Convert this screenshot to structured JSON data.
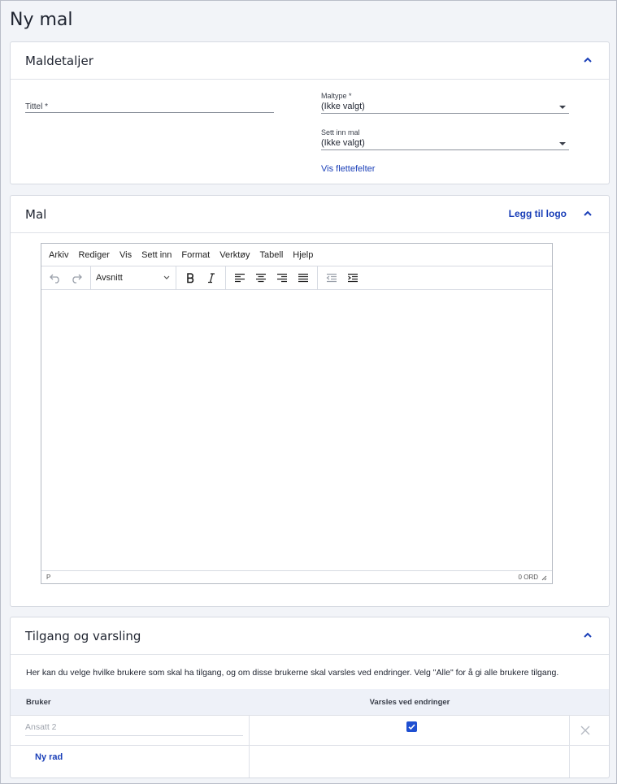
{
  "page": {
    "title": "Ny mal"
  },
  "details": {
    "title": "Maldetaljer",
    "tittel_label": "Tittel *",
    "tittel_value": "",
    "maltype_label": "Maltype *",
    "maltype_value": "(Ikke valgt)",
    "sett_inn_label": "Sett inn mal",
    "sett_inn_value": "(Ikke valgt)",
    "vis_flettefelter": "Vis flettefelter"
  },
  "mal": {
    "title": "Mal",
    "add_logo": "Legg til logo",
    "menu": [
      "Arkiv",
      "Rediger",
      "Vis",
      "Sett inn",
      "Format",
      "Verktøy",
      "Tabell",
      "Hjelp"
    ],
    "block_format": "Avsnitt",
    "status_path": "P",
    "word_count": "0 ORD"
  },
  "access": {
    "title": "Tilgang og varsling",
    "description": "Her kan du velge hvilke brukere som skal ha tilgang, og om disse brukerne skal varsles ved endringer. Velg \"Alle\" for å gi alle brukere tilgang.",
    "col_user": "Bruker",
    "col_notify": "Varsles ved endringer",
    "row_user_placeholder": "Ansatt 2",
    "row_notify_checked": true,
    "new_row": "Ny rad"
  },
  "colors": {
    "accent": "#1a3fb8",
    "checkbox": "#1f4fd1",
    "background": "#f2f4f8"
  },
  "icons": [
    "chevron-up-icon",
    "undo-icon",
    "redo-icon",
    "bold-icon",
    "italic-icon",
    "align-left-icon",
    "align-center-icon",
    "align-right-icon",
    "align-justify-icon",
    "outdent-icon",
    "indent-icon",
    "resize-handle-icon",
    "checkmark-icon",
    "close-icon"
  ]
}
